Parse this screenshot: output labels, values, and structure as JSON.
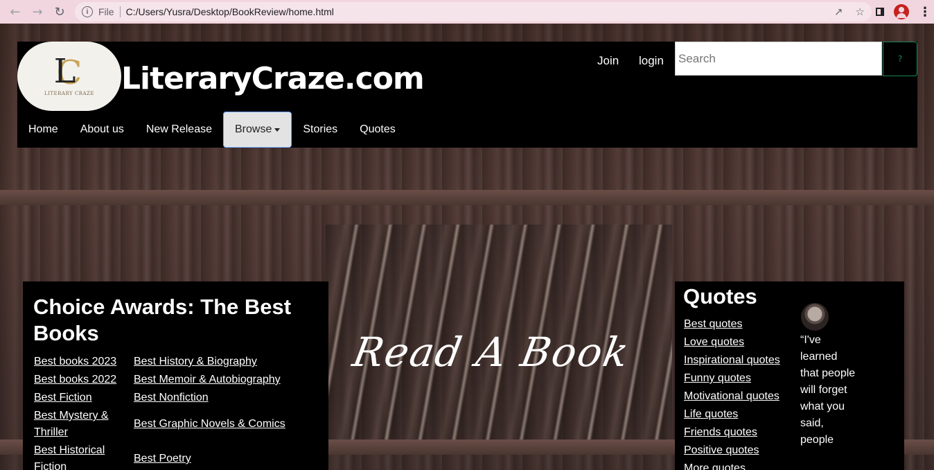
{
  "browser": {
    "scheme_label": "File",
    "url": "C:/Users/Yusra/Desktop/BookReview/home.html"
  },
  "header": {
    "logo_text": "LITERARY CRAZE",
    "site_title": "LiteraryCraze.com",
    "join_label": "Join",
    "login_label": "login",
    "search_placeholder": "Search",
    "search_button": "?"
  },
  "menu": {
    "items": [
      {
        "label": "Home"
      },
      {
        "label": "About us"
      },
      {
        "label": "New Release"
      },
      {
        "label": "Browse"
      },
      {
        "label": "Stories"
      },
      {
        "label": "Quotes"
      }
    ]
  },
  "hero": {
    "script_text": "Read A Book"
  },
  "awards": {
    "title": "Choice Awards: The Best Books",
    "col1": [
      "Best books 2023",
      "Best books 2022",
      "Best Fiction",
      "Best Mystery & Thriller",
      "Best Historical Fiction"
    ],
    "col2": [
      "Best History & Biography",
      "Best Memoir & Autobiography",
      "Best Nonfiction",
      "Best Graphic Novels & Comics",
      "Best Poetry"
    ]
  },
  "quotes": {
    "title": "Quotes",
    "links": [
      "Best quotes",
      "Love quotes",
      "Inspirational quotes",
      "Funny quotes",
      "Motivational quotes",
      "Life quotes",
      "Friends quotes",
      "Positive quotes",
      "More quotes..."
    ],
    "featured_text": "“I've learned that people will forget what you said, people"
  },
  "colors": {
    "chrome_bg": "#f2d6df",
    "header_bg": "#000000",
    "search_btn_border": "#198754",
    "active_menu_bg": "#e3e3e3"
  }
}
